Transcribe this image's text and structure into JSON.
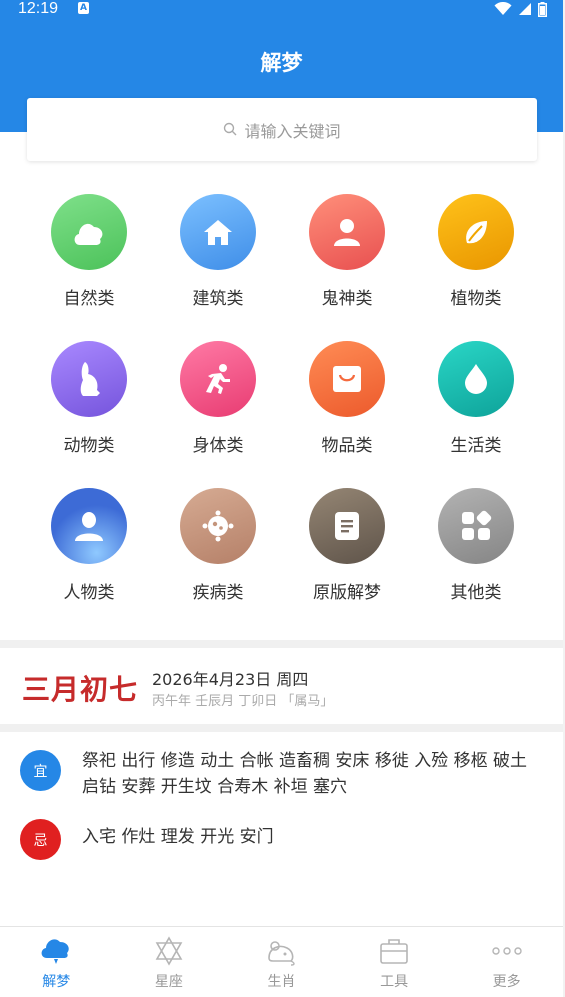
{
  "status_bar": {
    "time": "12:19",
    "notification_icon": "A"
  },
  "header": {
    "title": "解梦"
  },
  "search": {
    "placeholder": "请输入关键词"
  },
  "categories": [
    {
      "label": "自然类",
      "icon": "cloud-icon",
      "color": "#5fce6a"
    },
    {
      "label": "建筑类",
      "icon": "house-icon",
      "color": "#4a9ff0"
    },
    {
      "label": "鬼神类",
      "icon": "person-icon",
      "color": "#f26262"
    },
    {
      "label": "植物类",
      "icon": "leaf-icon",
      "color": "#f0a500"
    },
    {
      "label": "动物类",
      "icon": "rabbit-icon",
      "color": "#8a68e6"
    },
    {
      "label": "身体类",
      "icon": "running-person-icon",
      "color": "#f24f83"
    },
    {
      "label": "物品类",
      "icon": "shopping-bag-icon",
      "color": "#f56a3e"
    },
    {
      "label": "生活类",
      "icon": "water-drop-icon",
      "color": "#17b8b0"
    },
    {
      "label": "人物类",
      "icon": "user-icon",
      "color": "#3d6bd6"
    },
    {
      "label": "疾病类",
      "icon": "virus-icon",
      "color": "#c4957c"
    },
    {
      "label": "原版解梦",
      "icon": "document-icon",
      "color": "#7b6e63"
    },
    {
      "label": "其他类",
      "icon": "apps-icon",
      "color": "#9a9a9a"
    }
  ],
  "almanac": {
    "lunar_date": "三月初七",
    "solar_date": "2026年4月23日 周四",
    "ganzhi": "丙午年 壬辰月 丁卯日 「属马」",
    "yi_label": "宜",
    "yi_text": "祭祀 出行 修造 动土 合帐 造畜稠 安床 移徙 入殓 移柩 破土 启钻 安葬 开生坟 合寿木 补垣 塞穴",
    "ji_label": "忌",
    "ji_text": "入宅 作灶 理发 开光 安门",
    "yi_color": "#2587e6",
    "ji_color": "#e02020"
  },
  "tabs": [
    {
      "label": "解梦",
      "icon": "cloud-icon",
      "active": true
    },
    {
      "label": "星座",
      "icon": "star-of-david-icon",
      "active": false
    },
    {
      "label": "生肖",
      "icon": "mouse-icon",
      "active": false
    },
    {
      "label": "工具",
      "icon": "toolbox-icon",
      "active": false
    },
    {
      "label": "更多",
      "icon": "more-dots-icon",
      "active": false
    }
  ],
  "colors": {
    "primary": "#2587e6"
  }
}
